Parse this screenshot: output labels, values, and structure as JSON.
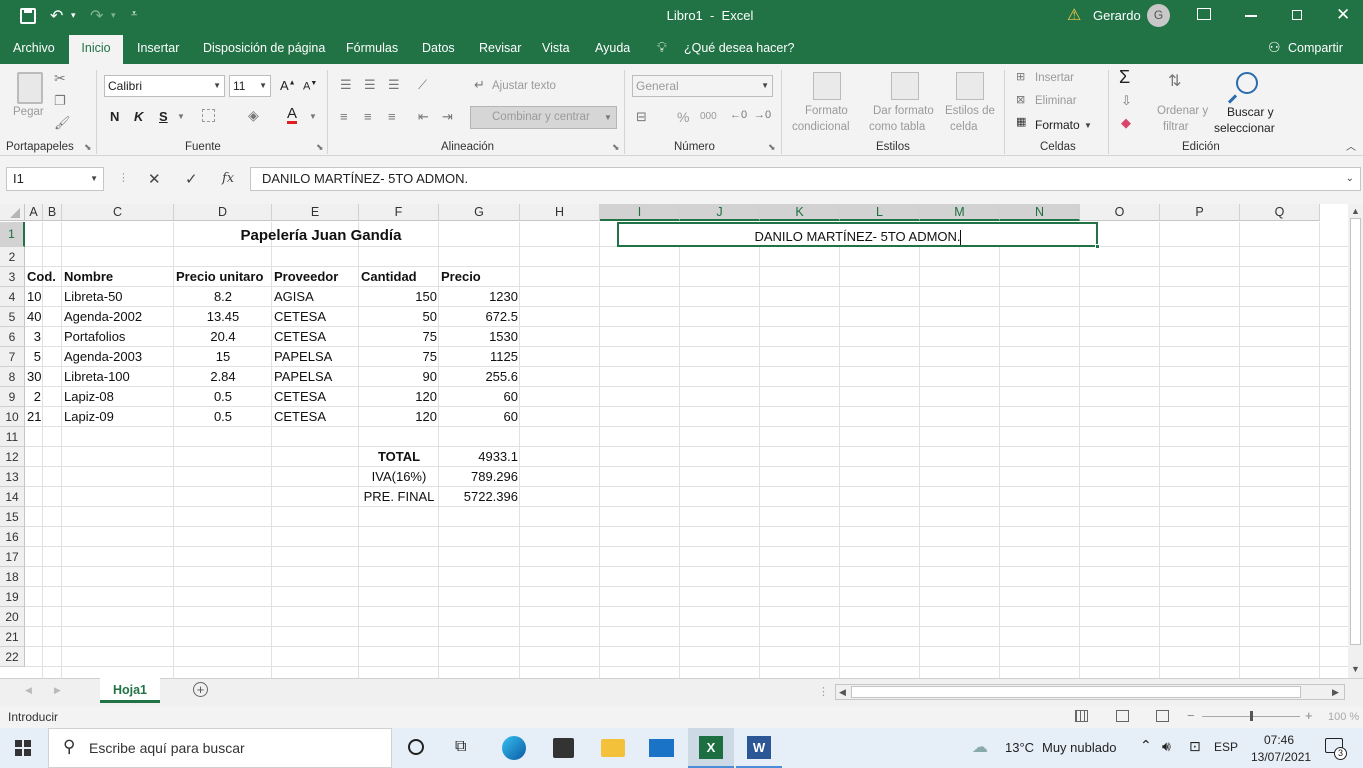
{
  "window": {
    "title": "Libro1  -  Excel",
    "user": "Gerardo",
    "user_initial": "G"
  },
  "menu": {
    "items": [
      "Archivo",
      "Inicio",
      "Insertar",
      "Disposición de página",
      "Fórmulas",
      "Datos",
      "Revisar",
      "Vista",
      "Ayuda"
    ],
    "active": "Inicio",
    "tell_me": "¿Qué desea hacer?",
    "share": "Compartir"
  },
  "ribbon": {
    "clipboard": {
      "paste": "Pegar",
      "label": "Portapapeles"
    },
    "font": {
      "name": "Calibri",
      "size": "11",
      "bold": "N",
      "italic": "K",
      "underline": "S",
      "label": "Fuente"
    },
    "alignment": {
      "wrap": "Ajustar texto",
      "merge": "Combinar y centrar",
      "label": "Alineación"
    },
    "number": {
      "format": "General",
      "percent": "%",
      "thousands": "000",
      "label": "Número"
    },
    "styles": {
      "conditional_1": "Formato",
      "conditional_2": "condicional",
      "table_1": "Dar formato",
      "table_2": "como tabla",
      "cell_1": "Estilos de",
      "cell_2": "celda",
      "label": "Estilos"
    },
    "cells": {
      "insert": "Insertar",
      "delete": "Eliminar",
      "format": "Formato",
      "label": "Celdas"
    },
    "editing": {
      "sort_1": "Ordenar y",
      "sort_2": "filtrar",
      "find_1": "Buscar y",
      "find_2": "seleccionar",
      "label": "Edición"
    }
  },
  "formula_bar": {
    "name_box": "I1",
    "fx": "fx",
    "content": "DANILO MARTÍNEZ- 5TO ADMON."
  },
  "columns": [
    "A",
    "B",
    "C",
    "D",
    "E",
    "F",
    "G",
    "H",
    "I",
    "J",
    "K",
    "L",
    "M",
    "N",
    "O",
    "P",
    "Q"
  ],
  "selected_columns": [
    "I",
    "J",
    "K",
    "L",
    "M",
    "N"
  ],
  "rows": [
    1,
    2,
    3,
    4,
    5,
    6,
    7,
    8,
    9,
    10,
    11,
    12,
    13,
    14,
    15,
    16,
    17,
    18,
    19,
    20,
    21,
    22
  ],
  "selected_row": 1,
  "sheet": {
    "title": "Papelería Juan Gandía",
    "selected_cell_text": "DANILO MARTÍNEZ- 5TO ADMON.",
    "headers": [
      "Cod.",
      "Nombre",
      "Precio unitaro",
      "Proveedor",
      "Cantidad",
      "Precio"
    ],
    "data": [
      [
        "10",
        "Libreta-50",
        "8.2",
        "AGISA",
        "150",
        "1230"
      ],
      [
        "40",
        "Agenda-2002",
        "13.45",
        "CETESA",
        "50",
        "672.5"
      ],
      [
        "3",
        "Portafolios",
        "20.4",
        "CETESA",
        "75",
        "1530"
      ],
      [
        "5",
        "Agenda-2003",
        "15",
        "PAPELSA",
        "75",
        "1125"
      ],
      [
        "30",
        "Libreta-100",
        "2.84",
        "PAPELSA",
        "90",
        "255.6"
      ],
      [
        "2",
        "Lapiz-08",
        "0.5",
        "CETESA",
        "120",
        "60"
      ],
      [
        "21",
        "Lapiz-09",
        "0.5",
        "CETESA",
        "120",
        "60"
      ]
    ],
    "totals": [
      [
        "TOTAL",
        "4933.1"
      ],
      [
        "IVA(16%)",
        "789.296"
      ],
      [
        "PRE. FINAL",
        "5722.396"
      ]
    ]
  },
  "tabs": {
    "active": "Hoja1",
    "add": "+"
  },
  "status": {
    "mode": "Introducir",
    "zoom": "100 %"
  },
  "taskbar": {
    "search_placeholder": "Escribe aquí para buscar",
    "weather_temp": "13°C",
    "weather_desc": "Muy nublado",
    "lang": "ESP",
    "time": "07:46",
    "date": "13/07/2021",
    "notifications": "3"
  },
  "colors": {
    "accent": "#217346",
    "ribbon_bg": "#f3f3f3",
    "selected_header": "#d2d2d2"
  }
}
